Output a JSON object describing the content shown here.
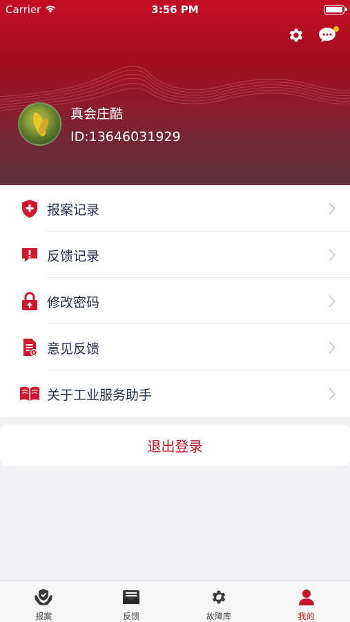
{
  "status_bar": {
    "carrier": "Carrier",
    "time": "3:56 PM"
  },
  "header": {
    "settings_icon": "gear-icon",
    "message_icon": "chat-bubble-icon",
    "has_notification": true
  },
  "profile": {
    "name": "真会庄酷",
    "id_text": "ID:13646031929"
  },
  "menu": {
    "items": [
      {
        "label": "报案记录",
        "icon": "shield-plus-icon"
      },
      {
        "label": "反馈记录",
        "icon": "alert-message-icon"
      },
      {
        "label": "修改密码",
        "icon": "lock-icon"
      },
      {
        "label": "意见反馈",
        "icon": "document-edit-icon"
      },
      {
        "label": "关于工业服务助手",
        "icon": "book-icon"
      }
    ]
  },
  "logout": {
    "label": "退出登录"
  },
  "tabbar": {
    "tabs": [
      {
        "label": "报案",
        "icon": "hands-shield-icon",
        "active": false
      },
      {
        "label": "反馈",
        "icon": "inbox-mail-icon",
        "active": false
      },
      {
        "label": "故障库",
        "icon": "gear-wrench-icon",
        "active": false
      },
      {
        "label": "我的",
        "icon": "user-icon",
        "active": true
      }
    ]
  },
  "colors": {
    "accent": "#c4152a",
    "text_primary": "#1f2d48",
    "notification_dot": "#f5c518"
  }
}
